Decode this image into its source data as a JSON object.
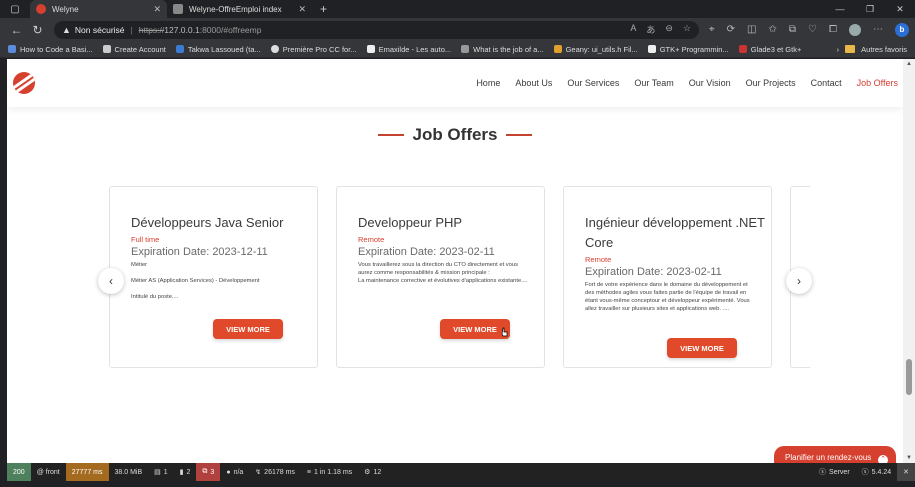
{
  "browser": {
    "tabs": [
      {
        "title": "Welyne",
        "active": true
      },
      {
        "title": "Welyne-OffreEmploi index",
        "active": false
      }
    ],
    "omnibox": {
      "security_label": "Non sécurisé",
      "scheme": "https://",
      "host": "127.0.0.1",
      "rest": ":8000/#offreemp"
    },
    "bookmarks": [
      "How to Code a Basi...",
      "Create Account",
      "Takwa Lassoued (ta...",
      "Première Pro CC for...",
      "Emaxilde - Les auto...",
      "What is the job of a...",
      "Geany: ui_utils.h Fil...",
      "GTK+ Programmin...",
      "Glade3 et Gtk+"
    ],
    "bookmarks_more": "Autres favoris"
  },
  "site": {
    "nav": [
      {
        "label": "Home",
        "active": false
      },
      {
        "label": "About Us",
        "active": false
      },
      {
        "label": "Our Services",
        "active": false
      },
      {
        "label": "Our Team",
        "active": false
      },
      {
        "label": "Our Vision",
        "active": false
      },
      {
        "label": "Our Projects",
        "active": false
      },
      {
        "label": "Contact",
        "active": false
      },
      {
        "label": "Job Offers",
        "active": true
      }
    ],
    "section_title": "Job Offers",
    "cards": [
      {
        "title": "Développeurs Java Senior",
        "type": "Full time",
        "expiration": "Expiration Date: 2023-12-11",
        "description": "Métier\n\nMétier AS (Application Services) - Développement\n\nIntitulé du poste....",
        "button": "VIEW MORE"
      },
      {
        "title": "Developpeur PHP",
        "type": "Remote",
        "expiration": "Expiration Date: 2023-02-11",
        "description": "Vous travaillerez sous la direction du CTO directement et vous aurez comme responsabilités & mission principale :\nLa maintenance corrective et évolutives d'applications existante....",
        "button": "VIEW MORE"
      },
      {
        "title": "Ingénieur développement .NET Core",
        "type": "Remote",
        "expiration": "Expiration Date: 2023-02-11",
        "description": "Fort de votre expérience dans le domaine du développement et des méthodes agiles vous faites partie de l'équipe de travail en étant vous-même conceptour et développeur expérimenté. Vous allez travailler sur plusieurs sites et applications web. ....",
        "button": "VIEW MORE"
      }
    ],
    "appointment_button": "Planifier un rendez-vous"
  },
  "debug_toolbar": {
    "status": "200",
    "route": "@ front",
    "time": "27777 ms",
    "memory": "38.0 MiB",
    "forms": "1",
    "logs": "2",
    "errors": "3",
    "user": "n/a",
    "ajax": "26178 ms",
    "db": "1 in 1.18 ms",
    "cache": "12",
    "server": "Server",
    "version": "5.4.24"
  },
  "colors": {
    "accent": "#d6402f",
    "button": "#e04a2a",
    "status_ok": "#4f805d",
    "status_time": "#a46a1f",
    "status_error": "#b0413e"
  }
}
